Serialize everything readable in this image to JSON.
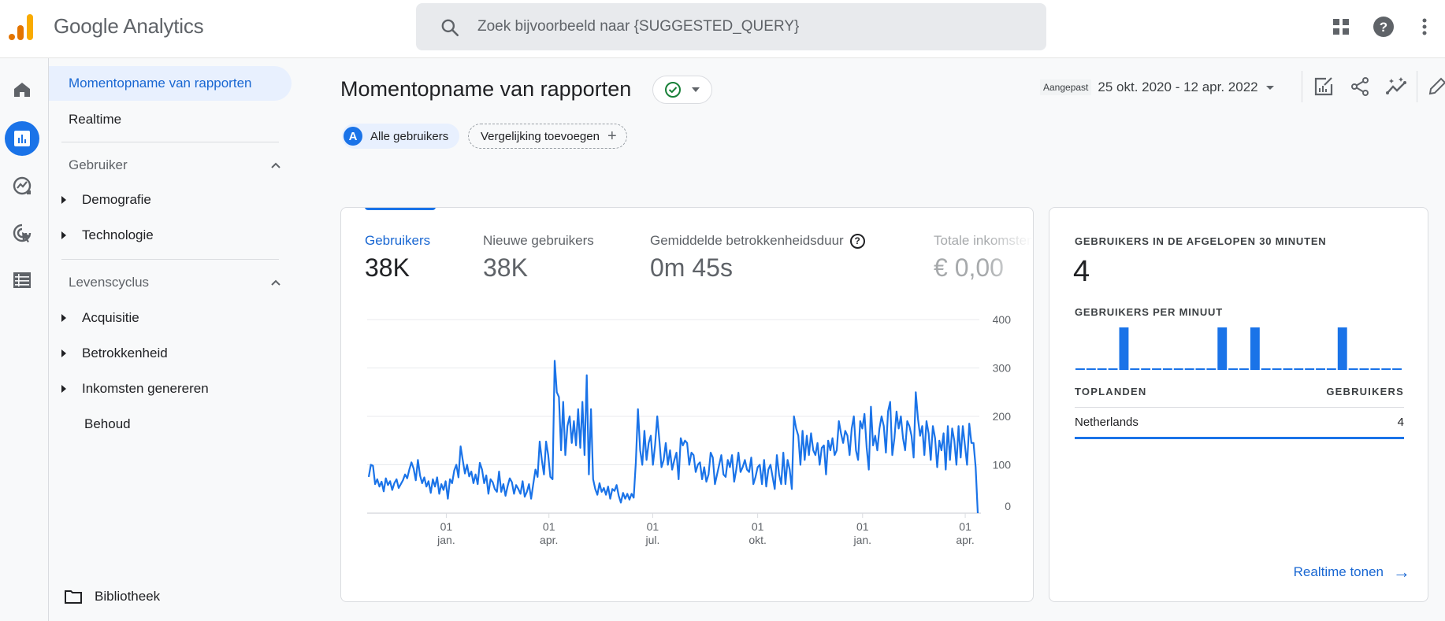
{
  "app": {
    "title": "Google Analytics",
    "logo_colors": [
      "#e37400",
      "#f9ab00"
    ]
  },
  "search": {
    "placeholder": "Zoek bijvoorbeeld naar {SUGGESTED_QUERY}",
    "value": ""
  },
  "top_icons": [
    "apps-icon",
    "help-icon",
    "more-vert-icon"
  ],
  "rail": {
    "items": [
      {
        "name": "home",
        "icon": "home-icon",
        "active": false
      },
      {
        "name": "reports",
        "icon": "bar-chart-icon",
        "active": true
      },
      {
        "name": "explore",
        "icon": "explore-icon",
        "active": false
      },
      {
        "name": "advertising",
        "icon": "target-cursor-icon",
        "active": false
      },
      {
        "name": "configure",
        "icon": "list-icon",
        "active": false
      }
    ]
  },
  "nav": {
    "items": [
      {
        "label": "Momentopname van rapporten",
        "active": true
      },
      {
        "label": "Realtime",
        "active": false
      }
    ],
    "sections": [
      {
        "label": "Gebruiker",
        "expanded": true,
        "children": [
          {
            "label": "Demografie",
            "has_children": true
          },
          {
            "label": "Technologie",
            "has_children": true
          }
        ]
      },
      {
        "label": "Levenscyclus",
        "expanded": true,
        "children": [
          {
            "label": "Acquisitie",
            "has_children": true
          },
          {
            "label": "Betrokkenheid",
            "has_children": true
          },
          {
            "label": "Inkomsten genereren",
            "has_children": true
          },
          {
            "label": "Behoud",
            "has_children": false
          }
        ]
      }
    ],
    "library_label": "Bibliotheek"
  },
  "page": {
    "title": "Momentopname van rapporten",
    "status": "ok",
    "segment_badge": "A",
    "segment_label": "Alle gebruikers",
    "compare_label": "Vergelijking toevoegen",
    "date_tag": "Aangepast",
    "date_range": "25 okt. 2020 - 12 apr. 2022"
  },
  "toolbar": {
    "icons": [
      "customize-report-icon",
      "share-icon",
      "insights-icon",
      "edit-icon"
    ]
  },
  "metrics": [
    {
      "label": "Gebruikers",
      "value": "38K",
      "active": true
    },
    {
      "label": "Nieuwe gebruikers",
      "value": "38K",
      "active": false
    },
    {
      "label": "Gemiddelde betrokkenheidsduur",
      "value": "0m 45s",
      "active": false,
      "help": "?"
    },
    {
      "label": "Totale inkomsten",
      "value": "€ 0,00",
      "active": false
    }
  ],
  "chart_data": {
    "type": "line",
    "title": "Gebruikers",
    "xlabel": "",
    "ylabel": "",
    "ylim": [
      0,
      400
    ],
    "yticks": [
      0,
      100,
      200,
      300,
      400
    ],
    "grid": true,
    "y_axis_side": "right",
    "x_range": [
      "2020-10-25",
      "2022-04-12"
    ],
    "x_ticks": [
      {
        "date": "2021-01-01",
        "day": "01",
        "month": "jan."
      },
      {
        "date": "2021-04-01",
        "day": "01",
        "month": "apr."
      },
      {
        "date": "2021-07-01",
        "day": "01",
        "month": "jul."
      },
      {
        "date": "2021-10-01",
        "day": "01",
        "month": "okt."
      },
      {
        "date": "2022-01-01",
        "day": "01",
        "month": "jan."
      },
      {
        "date": "2022-04-01",
        "day": "01",
        "month": "apr."
      }
    ],
    "series": [
      {
        "name": "Gebruikers",
        "color": "#1a73e8",
        "sampling": "every 3 days",
        "values": [
          75,
          100,
          98,
          60,
          70,
          55,
          65,
          45,
          72,
          58,
          66,
          48,
          62,
          70,
          52,
          60,
          68,
          80,
          72,
          90,
          105,
          92,
          68,
          110,
          78,
          62,
          74,
          55,
          66,
          42,
          70,
          55,
          74,
          40,
          60,
          48,
          66,
          30,
          70,
          62,
          88,
          100,
          74,
          138,
          110,
          82,
          100,
          76,
          86,
          62,
          80,
          60,
          104,
          90,
          62,
          78,
          40,
          70,
          64,
          50,
          44,
          86,
          44,
          60,
          36,
          56,
          72,
          64,
          40,
          58,
          50,
          40,
          66,
          34,
          44,
          60,
          30,
          60,
          90,
          75,
          148,
          110,
          80,
          148,
          120,
          75,
          70,
          315,
          250,
          240,
          130,
          230,
          120,
          180,
          200,
          145,
          190,
          140,
          215,
          135,
          230,
          120,
          285,
          80,
          215,
          70,
          50,
          38,
          62,
          44,
          52,
          38,
          55,
          30,
          50,
          46,
          58,
          36,
          22,
          42,
          30,
          40,
          28,
          40,
          32,
          105,
          215,
          130,
          100,
          170,
          110,
          145,
          160,
          100,
          140,
          200,
          150,
          95,
          110,
          145,
          100,
          130,
          90,
          110,
          125,
          70,
          155,
          140,
          150,
          145,
          100,
          125,
          120,
          85,
          100,
          105,
          70,
          95,
          65,
          80,
          125,
          115,
          60,
          80,
          100,
          120,
          80,
          75,
          110,
          95,
          120,
          65,
          90,
          125,
          85,
          95,
          110,
          90,
          85,
          115,
          60,
          75,
          95,
          100,
          60,
          110,
          55,
          90,
          100,
          75,
          50,
          120,
          80,
          60,
          125,
          60,
          110,
          90,
          50,
          200,
          175,
          160,
          100,
          170,
          110,
          160,
          120,
          165,
          130,
          120,
          145,
          100,
          135,
          140,
          80,
          150,
          130,
          155,
          120,
          130,
          190,
          165,
          145,
          170,
          160,
          120,
          175,
          200,
          130,
          110,
          190,
          175,
          205,
          135,
          90,
          220,
          140,
          160,
          130,
          175,
          200,
          180,
          125,
          210,
          230,
          120,
          155,
          210,
          175,
          200,
          155,
          130,
          190,
          180,
          160,
          115,
          250,
          195,
          160,
          180,
          120,
          190,
          165,
          110,
          180,
          155,
          95,
          150,
          130,
          165,
          90,
          180,
          110,
          175,
          150,
          100,
          180,
          115,
          180,
          140,
          100,
          185,
          145,
          145,
          95,
          0
        ]
      }
    ]
  },
  "realtime": {
    "heading": "GEBRUIKERS IN DE AFGELOPEN 30 MINUTEN",
    "value": "4",
    "per_minute_heading": "GEBRUIKERS PER MINUUT",
    "per_minute_chart": {
      "type": "bar",
      "categories_count": 30,
      "values": [
        0,
        0,
        0,
        0,
        1,
        0,
        0,
        0,
        0,
        0,
        0,
        0,
        0,
        1,
        0,
        0,
        1,
        0,
        0,
        0,
        0,
        0,
        0,
        0,
        1,
        0,
        0,
        0,
        0,
        0
      ],
      "color": "#1a73e8"
    },
    "table": {
      "col_country": "TOPLANDEN",
      "col_users": "GEBRUIKERS",
      "rows": [
        {
          "country": "Netherlands",
          "users": "4",
          "share": 1.0
        }
      ]
    },
    "link_label": "Realtime tonen"
  }
}
